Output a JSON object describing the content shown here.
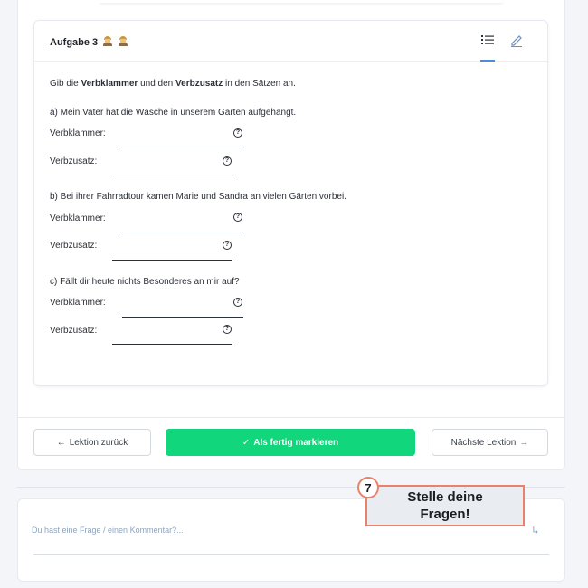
{
  "task": {
    "title": "Aufgabe 3",
    "instruction_parts": [
      "Gib die ",
      "Verbklammer",
      " und den ",
      "Verbzusatz",
      " in den Sätzen an."
    ],
    "questions": [
      {
        "text": "a) Mein Vater hat die Wäsche in unserem Garten aufgehängt.",
        "field1": "Verbklammer:",
        "field2": "Verbzusatz:"
      },
      {
        "text": "b) Bei ihrer Fahrradtour kamen Marie und Sandra an vielen Gärten vorbei.",
        "field1": "Verbklammer:",
        "field2": "Verbzusatz:"
      },
      {
        "text": "c) Fällt dir heute nichts Besonderes an mir auf?",
        "field1": "Verbklammer:",
        "field2": "Verbzusatz:"
      }
    ],
    "help_glyph": "?"
  },
  "nav": {
    "back_label": "Lektion zurück",
    "done_label": "Als fertig markieren",
    "next_label": "Nächste Lektion",
    "back_arrow": "←",
    "next_arrow": "→",
    "check_glyph": "✓"
  },
  "comment": {
    "placeholder": "Du hast eine Frage / einen Kommentar?...",
    "return_glyph": "↳"
  },
  "tooltip": {
    "step": "7",
    "line1": "Stelle deine",
    "line2": "Fragen!"
  },
  "colors": {
    "accent_green": "#12d67b",
    "tooltip_border": "#e8826d",
    "tab_active": "#4a8ed8"
  }
}
